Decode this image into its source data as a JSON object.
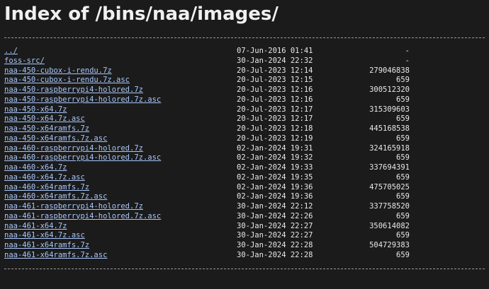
{
  "title": "Index of /bins/naa/images/",
  "entries": [
    {
      "name": "../",
      "date": "07-Jun-2016 01:41",
      "size": "-"
    },
    {
      "name": "foss-src/",
      "date": "30-Jan-2024 22:32",
      "size": "-"
    },
    {
      "name": "naa-450-cubox-i-rendu.7z",
      "date": "20-Jul-2023 12:14",
      "size": "279046838"
    },
    {
      "name": "naa-450-cubox-i-rendu.7z.asc",
      "date": "20-Jul-2023 12:15",
      "size": "659"
    },
    {
      "name": "naa-450-raspberrypi4-holored.7z",
      "date": "20-Jul-2023 12:16",
      "size": "300512320"
    },
    {
      "name": "naa-450-raspberrypi4-holored.7z.asc",
      "date": "20-Jul-2023 12:16",
      "size": "659"
    },
    {
      "name": "naa-450-x64.7z",
      "date": "20-Jul-2023 12:17",
      "size": "315309603"
    },
    {
      "name": "naa-450-x64.7z.asc",
      "date": "20-Jul-2023 12:17",
      "size": "659"
    },
    {
      "name": "naa-450-x64ramfs.7z",
      "date": "20-Jul-2023 12:18",
      "size": "445168538"
    },
    {
      "name": "naa-450-x64ramfs.7z.asc",
      "date": "20-Jul-2023 12:19",
      "size": "659"
    },
    {
      "name": "naa-460-raspberrypi4-holored.7z",
      "date": "02-Jan-2024 19:31",
      "size": "324165918"
    },
    {
      "name": "naa-460-raspberrypi4-holored.7z.asc",
      "date": "02-Jan-2024 19:32",
      "size": "659"
    },
    {
      "name": "naa-460-x64.7z",
      "date": "02-Jan-2024 19:33",
      "size": "337694391"
    },
    {
      "name": "naa-460-x64.7z.asc",
      "date": "02-Jan-2024 19:35",
      "size": "659"
    },
    {
      "name": "naa-460-x64ramfs.7z",
      "date": "02-Jan-2024 19:36",
      "size": "475705025"
    },
    {
      "name": "naa-460-x64ramfs.7z.asc",
      "date": "02-Jan-2024 19:36",
      "size": "659"
    },
    {
      "name": "naa-461-raspberrypi4-holored.7z",
      "date": "30-Jan-2024 22:12",
      "size": "337758520"
    },
    {
      "name": "naa-461-raspberrypi4-holored.7z.asc",
      "date": "30-Jan-2024 22:26",
      "size": "659"
    },
    {
      "name": "naa-461-x64.7z",
      "date": "30-Jan-2024 22:27",
      "size": "350614082"
    },
    {
      "name": "naa-461-x64.7z.asc",
      "date": "30-Jan-2024 22:27",
      "size": "659"
    },
    {
      "name": "naa-461-x64ramfs.7z",
      "date": "30-Jan-2024 22:28",
      "size": "504729383"
    },
    {
      "name": "naa-461-x64ramfs.7z.asc",
      "date": "30-Jan-2024 22:28",
      "size": "659"
    }
  ]
}
